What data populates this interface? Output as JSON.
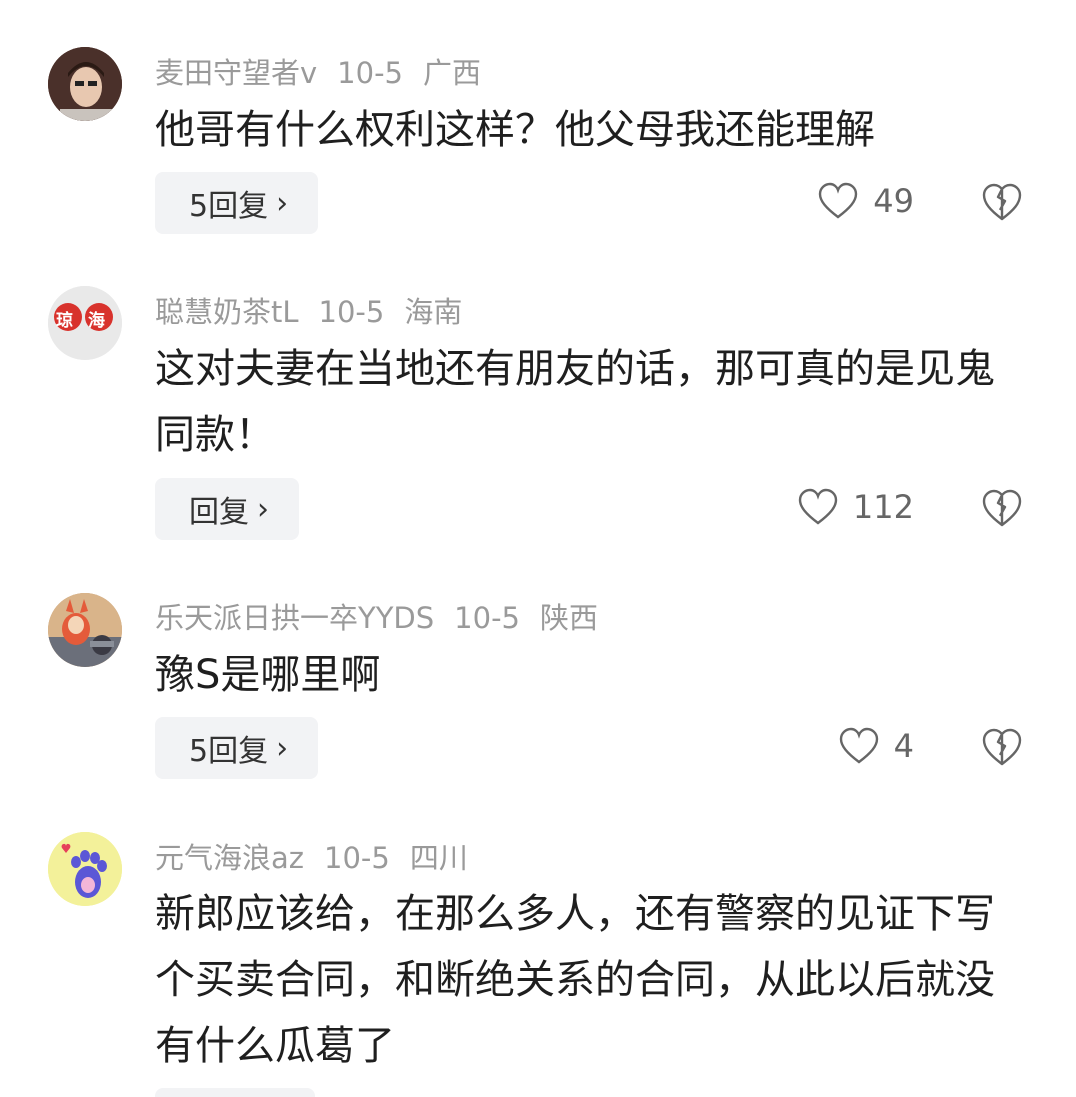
{
  "comments": [
    {
      "username": "麦田守望者v",
      "date": "10-5",
      "location": "广西",
      "text": "他哥有什么权利这样？他父母我还能理解",
      "reply_label": "5回复",
      "likes": "49"
    },
    {
      "username": "聪慧奶茶tL",
      "date": "10-5",
      "location": "海南",
      "text": "这对夫妻在当地还有朋友的话，那可真的是见鬼同款！",
      "reply_label": "回复",
      "likes": "112",
      "avatar_text_1": "琼",
      "avatar_text_2": "海"
    },
    {
      "username": "乐天派日拱一卒YYDS",
      "date": "10-5",
      "location": "陕西",
      "text": "豫S是哪里啊",
      "reply_label": "5回复",
      "likes": "4"
    },
    {
      "username": "元气海浪az",
      "date": "10-5",
      "location": "四川",
      "text": "新郎应该给，在那么多人，还有警察的见证下写个买卖合同，和断绝关系的合同，从此以后就没有什么瓜葛了"
    }
  ],
  "icons": {
    "like": "heart-outline-icon",
    "dislike": "broken-heart-icon",
    "chevron": "chevron-right-icon"
  },
  "colors": {
    "meta": "#9a9a9a",
    "reply_bg": "#f2f3f5",
    "avatar4_bg": "#f3f19a",
    "avatar4_paw": "#5b57d6"
  }
}
